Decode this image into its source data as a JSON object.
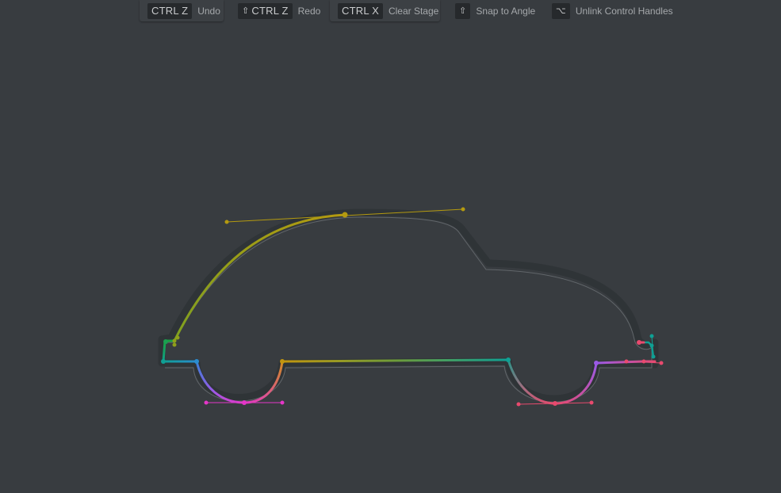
{
  "toolbar": {
    "undo": {
      "key": "CTRL Z",
      "label": "Undo"
    },
    "redo": {
      "glyph": "⇧",
      "key": "CTRL Z",
      "label": "Redo"
    },
    "clear": {
      "key": "CTRL X",
      "label": "Clear Stage"
    },
    "snap": {
      "key": "⇧",
      "label": "Snap to Angle"
    },
    "unlink": {
      "key": "⌥",
      "label": "Unlink Control Handles"
    }
  },
  "colors": {
    "background": "#383c40",
    "toolbar_box": "#3c4044",
    "key_bg": "#26292c",
    "shadow_outline": "#2e3235",
    "thin_outline": "#6c7074",
    "yellow": "#b49a10",
    "olive": "#96a01a",
    "green": "#1aa060",
    "teal": "#0fa094",
    "blue": "#2a8cd0",
    "purple": "#9a5ae6",
    "magenta": "#e436c8",
    "orange": "#d08a26",
    "gold": "#c2960e",
    "pink": "#e84a7a",
    "red": "#e84a6e"
  }
}
